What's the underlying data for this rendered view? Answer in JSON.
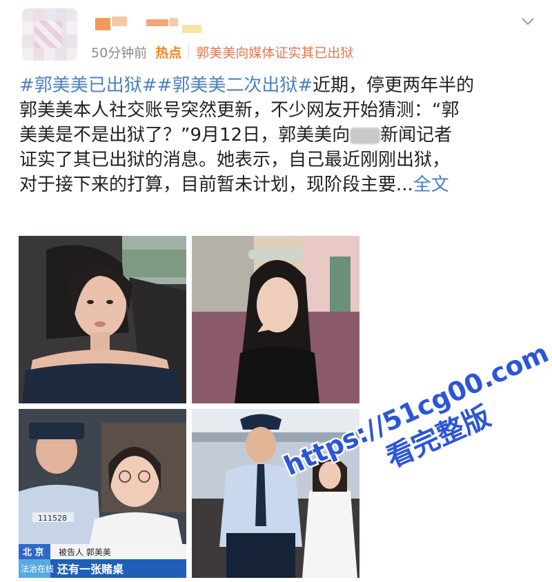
{
  "post": {
    "time": "50分钟前",
    "hot_label": "热点",
    "topic": "郭美美向媒体证实其已出狱",
    "lines": [
      {
        "hashtag": "#郭美美已出狱##郭美美二次出狱#",
        "text": "近期，停更两年半的"
      },
      {
        "text": "郭美美本人社交账号突然更新，不少网友开始猜测：“郭"
      },
      {
        "text_a": "美美是不是出狱了？”9月12日，郭美美向",
        "text_b": "新闻记者"
      },
      {
        "text": "证实了其已出狱的消息。她表示，自己最近刚刚出狱，"
      },
      {
        "text": "对于接下来的打算，目前暂未计划，现阶段主要...",
        "more": "全文"
      }
    ]
  },
  "photos": {
    "caption_city": "北 京",
    "caption_defendant": "被告人 郭美美",
    "caption_channel": "法治在线",
    "caption_subtitle": "还有一张赌桌",
    "badge_number": "111528"
  },
  "watermark": {
    "url": "https://51cg00.com",
    "slogan": "看完整版"
  },
  "colors": {
    "link": "#4d7fbf",
    "hot": "#f7821b",
    "topic": "#eb7350",
    "watermark": "#2c56d8"
  }
}
